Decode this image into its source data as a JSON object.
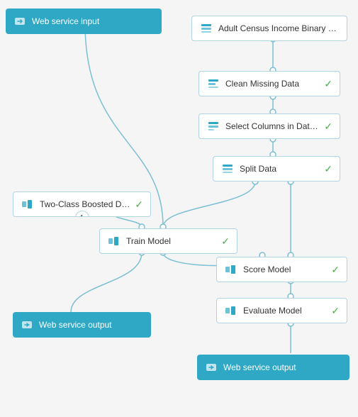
{
  "nodes": {
    "web_service_input": {
      "label": "Web service input",
      "type": "blue",
      "icon": "input"
    },
    "adult_census": {
      "label": "Adult Census Income Binary …",
      "type": "white",
      "icon": "dataset"
    },
    "clean_missing": {
      "label": "Clean Missing Data",
      "type": "white",
      "icon": "transform",
      "check": true
    },
    "select_columns": {
      "label": "Select Columns in Dataset",
      "type": "white",
      "icon": "transform",
      "check": true
    },
    "split_data": {
      "label": "Split Data",
      "type": "white",
      "icon": "transform",
      "check": true
    },
    "two_class": {
      "label": "Two-Class Boosted Decision …",
      "type": "white",
      "icon": "model",
      "check": true,
      "badge": "1"
    },
    "train_model": {
      "label": "Train Model",
      "type": "white",
      "icon": "train",
      "check": true
    },
    "score_model": {
      "label": "Score Model",
      "type": "white",
      "icon": "score",
      "check": true
    },
    "evaluate_model": {
      "label": "Evaluate Model",
      "type": "white",
      "icon": "evaluate",
      "check": true
    },
    "web_service_output_left": {
      "label": "Web service output",
      "type": "blue",
      "icon": "output"
    },
    "web_service_output_right": {
      "label": "Web service output",
      "type": "blue",
      "icon": "output"
    }
  },
  "colors": {
    "blue": "#2ea8c5",
    "white_border": "#b0d4e8",
    "check": "#4caf50",
    "line": "#7bbfd4"
  }
}
